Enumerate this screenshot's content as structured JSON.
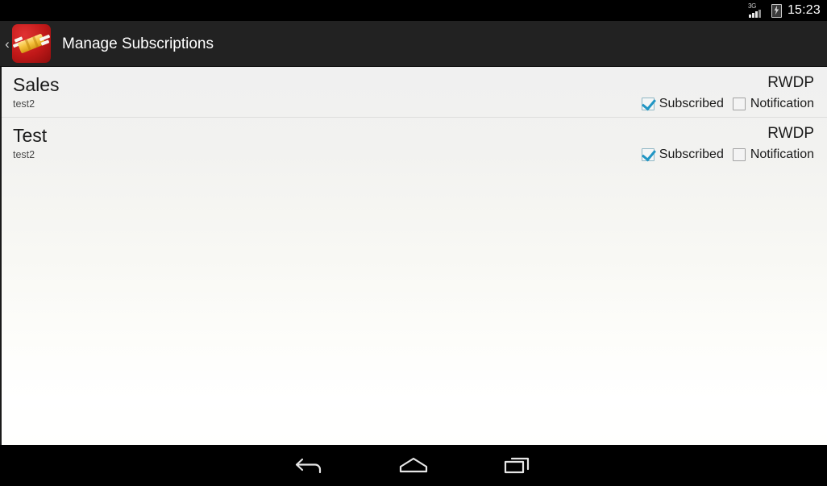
{
  "status_bar": {
    "network_label": "3G",
    "signal_icon": "signal-bars-icon",
    "battery_icon": "battery-charging-icon",
    "time": "15:23"
  },
  "action_bar": {
    "up_chevron": "‹",
    "app_icon": "app-logo-icon",
    "title": "Manage Subscriptions"
  },
  "list": {
    "rows": [
      {
        "title": "Sales",
        "subtitle": "test2",
        "code": "RWDP",
        "subscribed_label": "Subscribed",
        "subscribed_checked": true,
        "notification_label": "Notification",
        "notification_checked": false
      },
      {
        "title": "Test",
        "subtitle": "test2",
        "code": "RWDP",
        "subscribed_label": "Subscribed",
        "subscribed_checked": true,
        "notification_label": "Notification",
        "notification_checked": false
      }
    ]
  },
  "nav_bar": {
    "back_icon": "back-arrow-icon",
    "home_icon": "home-icon",
    "recents_icon": "recent-apps-icon"
  },
  "colors": {
    "status_bar_bg": "#000000",
    "action_bar_bg": "#222222",
    "app_icon_red": "#c01818",
    "app_icon_gold": "#f5c13c",
    "checkbox_accent": "#2196c4",
    "content_bg_top": "#f0f0f0",
    "content_bg_bottom": "#ffffff"
  }
}
